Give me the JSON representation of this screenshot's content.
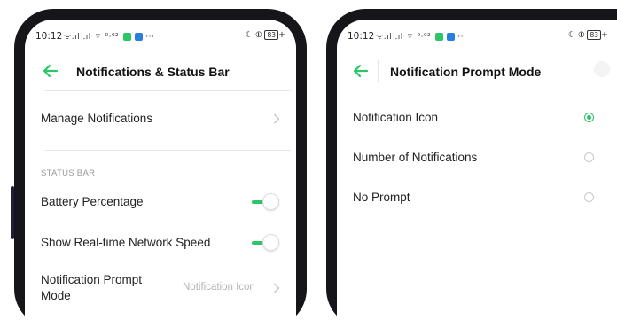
{
  "left_phone": {
    "status_bar": {
      "time": "10:12",
      "signal_icons": "ᯤ.ıl .ıl ⌔ ⁰·⁰²",
      "battery": "83"
    },
    "header": {
      "title": "Notifications & Status Bar"
    },
    "manage_notifications": {
      "label": "Manage Notifications"
    },
    "section_status_bar": {
      "label": "STATUS BAR"
    },
    "battery_percentage": {
      "label": "Battery Percentage",
      "enabled": true
    },
    "network_speed": {
      "label": "Show Real-time Network Speed",
      "enabled": true
    },
    "prompt_mode": {
      "label_line1": "Notification Prompt",
      "label_line2": "Mode",
      "value": "Notification Icon"
    }
  },
  "right_phone": {
    "status_bar": {
      "time": "10:12",
      "signal_icons": "ᯤ.ıl .ıl ⌔ ⁰·⁰²",
      "battery": "83"
    },
    "header": {
      "title": "Notification Prompt Mode"
    },
    "options": [
      {
        "label": "Notification Icon",
        "selected": true
      },
      {
        "label": "Number of Notifications",
        "selected": false
      },
      {
        "label": "No Prompt",
        "selected": false
      }
    ]
  },
  "colors": {
    "accent": "#2cc569",
    "phone_frame": "#15151a",
    "secondary_text": "#9a9a9a"
  }
}
